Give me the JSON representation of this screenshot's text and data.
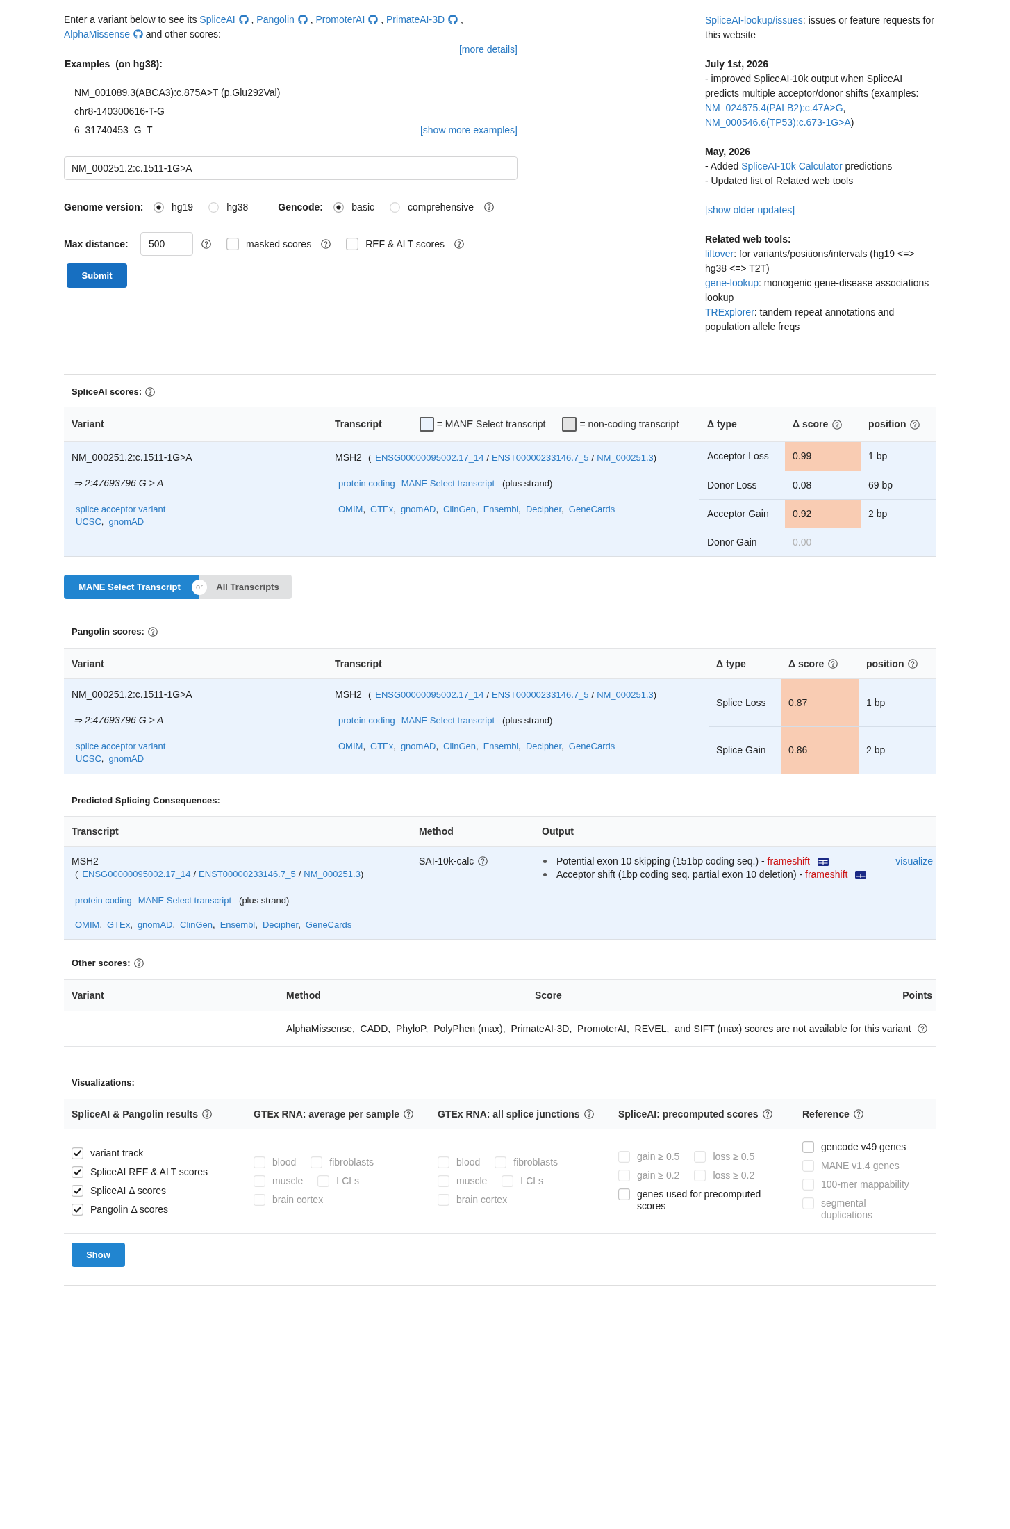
{
  "intro": {
    "parts": [
      {
        "kind": "text",
        "text": "Enter a variant below to see its "
      },
      {
        "kind": "tool",
        "text": "SpliceAI"
      },
      {
        "kind": "text",
        "text": " , "
      },
      {
        "kind": "tool",
        "text": "Pangolin"
      },
      {
        "kind": "text",
        "text": " , "
      },
      {
        "kind": "tool",
        "text": "PromoterAI"
      },
      {
        "kind": "text",
        "text": " , "
      },
      {
        "kind": "tool",
        "text": "PrimateAI-3D"
      },
      {
        "kind": "text",
        "text": " , "
      },
      {
        "kind": "tool",
        "text": "AlphaMissense"
      },
      {
        "kind": "text",
        "text": " and other scores:"
      }
    ]
  },
  "more_details": "[more details]",
  "examples": {
    "title": "Examples  (on hg38):",
    "items": [
      "NM_001089.3(ABCA3):c.875A>T (p.Glu292Val)",
      "chr8-140300616-T-G",
      "6  31740453  G  T"
    ],
    "more": "[show more examples]"
  },
  "variant_input": {
    "value": "NM_000251.2:c.1511-1G>A"
  },
  "genome": {
    "label": "Genome version:",
    "options": [
      {
        "label": "hg19",
        "selected": true
      },
      {
        "label": "hg38",
        "selected": false
      }
    ]
  },
  "gencode": {
    "label": "Gencode:",
    "options": [
      {
        "label": "basic",
        "selected": true
      },
      {
        "label": "comprehensive",
        "selected": false
      }
    ]
  },
  "max_distance": {
    "label": "Max distance:",
    "value": "500"
  },
  "score_options": [
    {
      "label": "masked scores",
      "checked": false
    },
    {
      "label": "REF & ALT scores",
      "checked": false
    }
  ],
  "submit": "Submit",
  "issues": {
    "parts": [
      {
        "kind": "link",
        "text": "SpliceAI-lookup/issues"
      },
      {
        "kind": "text",
        "text": ": issues or feature requests for this website"
      }
    ]
  },
  "news": [
    {
      "date": "July 1st, 2026",
      "lines": [
        {
          "parts": [
            {
              "kind": "text",
              "text": "- improved SpliceAI-10k output when SpliceAI predicts multiple acceptor/donor shifts (examples: "
            },
            {
              "kind": "link",
              "text": "NM_024675.4(PALB2):c.47A>G"
            },
            {
              "kind": "text",
              "text": ", "
            },
            {
              "kind": "link",
              "text": "NM_000546.6(TP53):c.673-1G>A"
            },
            {
              "kind": "text",
              "text": ")"
            }
          ]
        }
      ]
    },
    {
      "date": "May, 2026",
      "lines": [
        {
          "parts": [
            {
              "kind": "text",
              "text": "- Added "
            },
            {
              "kind": "link",
              "text": "SpliceAI-10k Calculator"
            },
            {
              "kind": "text",
              "text": " predictions"
            }
          ]
        },
        {
          "parts": [
            {
              "kind": "text",
              "text": "- Updated list of Related web tools"
            }
          ]
        }
      ]
    }
  ],
  "older_updates": "[show older updates]",
  "related": {
    "title": "Related web tools:",
    "items": [
      {
        "parts": [
          {
            "kind": "link",
            "text": "liftover"
          },
          {
            "kind": "text",
            "text": ": for variants/positions/intervals (hg19 <=> hg38 <=> T2T)"
          }
        ]
      },
      {
        "parts": [
          {
            "kind": "link",
            "text": "gene-lookup"
          },
          {
            "kind": "text",
            "text": ": monogenic gene-disease associations lookup"
          }
        ]
      },
      {
        "parts": [
          {
            "kind": "link",
            "text": "TRExplorer"
          },
          {
            "kind": "text",
            "text": ": tandem repeat annotations and population allele freqs"
          }
        ]
      }
    ]
  },
  "spliceai": {
    "title": "SpliceAI scores:",
    "help": true,
    "columns": [
      {
        "label": "Variant"
      },
      {
        "label": "Transcript"
      },
      {
        "label": "Δ type"
      },
      {
        "label": "Δ score",
        "help": true
      },
      {
        "label": "position",
        "help": true
      }
    ],
    "legend": [
      {
        "text": "= MANE Select transcript",
        "color": "#eaf2fd"
      },
      {
        "text": "= non-coding transcript",
        "color": "#e4e4e4"
      }
    ],
    "variant": {
      "name": "NM_000251.2:c.1511-1G>A",
      "position": "⇒ 2:47693796 G > A",
      "consequence": "splice acceptor variant",
      "links": {
        "sep": ",",
        "items": [
          "UCSC",
          "gnomAD"
        ]
      }
    },
    "transcript": {
      "gene": "MSH2",
      "ids": {
        "open": "(",
        "sep": "/",
        "close": ")",
        "items": [
          "ENSG00000095002.17_14",
          "ENST00000233146.7_5",
          "NM_000251.3"
        ]
      },
      "tags": [
        "protein coding",
        "MANE Select transcript"
      ],
      "strand": "(plus strand)",
      "resources": {
        "sep": ",",
        "items": [
          "OMIM",
          "GTEx",
          "gnomAD",
          "ClinGen",
          "Ensembl",
          "Decipher",
          "GeneCards"
        ]
      }
    },
    "rows": [
      {
        "type": "Acceptor Loss",
        "score": "0.99",
        "position": "1 bp",
        "highlight": true,
        "dimmed": false
      },
      {
        "type": "Donor Loss",
        "score": "0.08",
        "position": "69 bp",
        "highlight": false,
        "dimmed": false
      },
      {
        "type": "Acceptor Gain",
        "score": "0.92",
        "position": "2 bp",
        "highlight": true,
        "dimmed": false
      },
      {
        "type": "Donor Gain",
        "score": "0.00",
        "highlight": false,
        "dimmed": true
      }
    ]
  },
  "transcript_toggle": {
    "options": [
      {
        "label": "MANE Select Transcript",
        "selected": true
      },
      {
        "label": "All Transcripts",
        "selected": false
      }
    ],
    "or": "or"
  },
  "pangolin": {
    "title": "Pangolin scores:",
    "help": true,
    "columns": [
      {
        "label": "Variant"
      },
      {
        "label": "Transcript"
      },
      {
        "label": "Δ type"
      },
      {
        "label": "Δ score",
        "help": true
      },
      {
        "label": "position",
        "help": true
      }
    ],
    "variant": {
      "name": "NM_000251.2:c.1511-1G>A",
      "position": "⇒ 2:47693796 G > A",
      "consequence": "splice acceptor variant",
      "links": {
        "sep": ",",
        "items": [
          "UCSC",
          "gnomAD"
        ]
      }
    },
    "transcript": {
      "gene": "MSH2",
      "ids": {
        "open": "(",
        "sep": "/",
        "close": ")",
        "items": [
          "ENSG00000095002.17_14",
          "ENST00000233146.7_5",
          "NM_000251.3"
        ]
      },
      "tags": [
        "protein coding",
        "MANE Select transcript"
      ],
      "strand": "(plus strand)",
      "resources": {
        "sep": ",",
        "items": [
          "OMIM",
          "GTEx",
          "gnomAD",
          "ClinGen",
          "Ensembl",
          "Decipher",
          "GeneCards"
        ]
      }
    },
    "rows": [
      {
        "type": "Splice Loss",
        "score": "0.87",
        "position": "1 bp",
        "highlight": true,
        "dimmed": false
      },
      {
        "type": "Splice Gain",
        "score": "0.86",
        "position": "2 bp",
        "highlight": true,
        "dimmed": false
      }
    ]
  },
  "consequences": {
    "title": "Predicted Splicing Consequences:",
    "columns": [
      {
        "label": "Transcript"
      },
      {
        "label": "Method"
      },
      {
        "label": "Output"
      }
    ],
    "transcript": {
      "gene": "MSH2",
      "ids": {
        "open": "(",
        "sep": "/",
        "close": ")",
        "items": [
          "ENSG00000095002.17_14",
          "ENST00000233146.7_5",
          "NM_000251.3"
        ]
      },
      "tags": [
        "protein coding",
        "MANE Select transcript"
      ],
      "strand": "(plus strand)",
      "resources": {
        "sep": ",",
        "items": [
          "OMIM",
          "GTEx",
          "gnomAD",
          "ClinGen",
          "Ensembl",
          "Decipher",
          "GeneCards"
        ]
      }
    },
    "method": {
      "label": "SAI-10k-calc",
      "help": true
    },
    "outputs": [
      {
        "text": "Potential exon 10 skipping (151bp coding seq.) -",
        "effect": "frameshift"
      },
      {
        "text": "Acceptor shift (1bp coding seq. partial exon 10 deletion) -",
        "effect": "frameshift"
      }
    ],
    "visualize": "visualize"
  },
  "other_scores": {
    "title": "Other scores:",
    "help": true,
    "columns": [
      {
        "label": "Variant"
      },
      {
        "label": "Method"
      },
      {
        "label": "Score"
      },
      {
        "label": "Points"
      }
    ],
    "message": "AlphaMissense,  CADD,  PhyloP,  PolyPhen (max),  PrimateAI-3D,  PromoterAI,  REVEL,  and SIFT (max) scores are not available for this variant"
  },
  "visualizations": {
    "title": "Visualizations:",
    "groups": [
      {
        "title": "SpliceAI & Pangolin results",
        "help": true,
        "rows": [
          [
            {
              "label": "variant track",
              "checked": true,
              "disabled": false
            }
          ],
          [
            {
              "label": "SpliceAI REF & ALT scores",
              "checked": true,
              "disabled": false
            }
          ],
          [
            {
              "label": "SpliceAI Δ scores",
              "checked": true,
              "disabled": false
            }
          ],
          [
            {
              "label": "Pangolin Δ scores",
              "checked": true,
              "disabled": false
            }
          ]
        ]
      },
      {
        "title": "GTEx RNA: average per sample",
        "help": true,
        "rows": [
          [
            {
              "label": "blood",
              "checked": false,
              "disabled": true
            },
            {
              "label": "fibroblasts",
              "checked": false,
              "disabled": true
            }
          ],
          [
            {
              "label": "muscle",
              "checked": false,
              "disabled": true
            },
            {
              "label": "LCLs",
              "checked": false,
              "disabled": true
            }
          ],
          [
            {
              "label": "brain cortex",
              "checked": false,
              "disabled": true
            }
          ]
        ]
      },
      {
        "title": "GTEx RNA: all splice junctions",
        "help": true,
        "rows": [
          [
            {
              "label": "blood",
              "checked": false,
              "disabled": true
            },
            {
              "label": "fibroblasts",
              "checked": false,
              "disabled": true
            }
          ],
          [
            {
              "label": "muscle",
              "checked": false,
              "disabled": true
            },
            {
              "label": "LCLs",
              "checked": false,
              "disabled": true
            }
          ],
          [
            {
              "label": "brain cortex",
              "checked": false,
              "disabled": true
            }
          ]
        ]
      },
      {
        "title": "SpliceAI: precomputed scores",
        "help": true,
        "rows": [
          [
            {
              "label": "gain ≥ 0.5",
              "checked": false,
              "disabled": true
            },
            {
              "label": "loss ≥ 0.5",
              "checked": false,
              "disabled": true
            }
          ],
          [
            {
              "label": "gain ≥ 0.2",
              "checked": false,
              "disabled": true
            },
            {
              "label": "loss ≥ 0.2",
              "checked": false,
              "disabled": true
            }
          ],
          [
            {
              "label": "genes used for precomputed scores",
              "checked": false,
              "disabled": false
            }
          ]
        ]
      },
      {
        "title": "Reference",
        "help": true,
        "rows": [
          [
            {
              "label": "gencode v49 genes",
              "checked": false,
              "disabled": false
            }
          ],
          [
            {
              "label": "MANE v1.4 genes",
              "checked": false,
              "disabled": true
            }
          ],
          [
            {
              "label": "100-mer mappability",
              "checked": false,
              "disabled": true
            }
          ],
          [
            {
              "label": "segmental duplications",
              "checked": false,
              "disabled": true
            }
          ]
        ]
      }
    ],
    "button": "Show"
  }
}
